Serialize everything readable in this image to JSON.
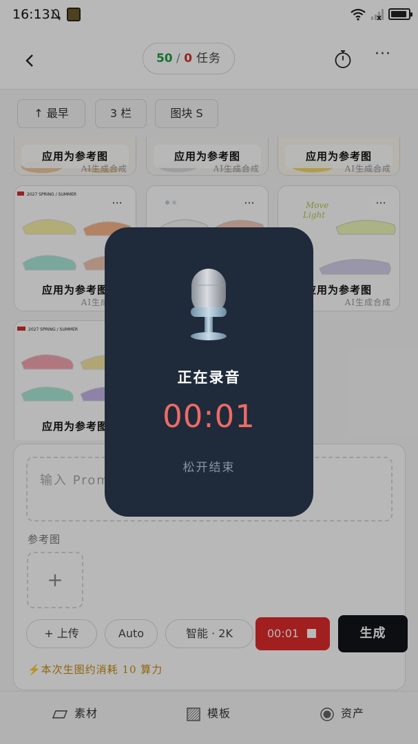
{
  "status_bar": {
    "time": "16:13"
  },
  "header": {
    "back_icon": "chevron-left-icon",
    "tasks_done": "50",
    "tasks_sep": " / ",
    "tasks_failed": "0",
    "tasks_label": "任务",
    "timer_icon": "stopwatch-icon",
    "more_icon": "more-horizontal-icon",
    "more_label": "···"
  },
  "filters": {
    "sort": "↑  最早",
    "columns": "3 栏",
    "tile_size": "图块 S"
  },
  "grid": {
    "apply_label": "应用为参考图",
    "ai_watermark": "AI生成合成",
    "card_more": "···",
    "card_title_text": "2027 SPRING / SUMMER"
  },
  "composer": {
    "prompt_placeholder": "输入 Prompt",
    "reference_label": "参考图",
    "add_reference": "+",
    "upload_button": "+  上传",
    "ratio_button": "Auto",
    "quality_button": "智能  ·  2K",
    "recording_timer": "00:01",
    "generate_button": "生成",
    "cost_note": "⚡本次生图约消耗 10 算力"
  },
  "bottom_nav": {
    "items": [
      {
        "label": "素材",
        "icon": "material-icon"
      },
      {
        "label": "模板",
        "icon": "template-icon"
      },
      {
        "label": "资产",
        "icon": "asset-icon"
      }
    ]
  },
  "recording": {
    "title": "正在录音",
    "time": "00:01",
    "hint": "松开结束",
    "icon": "microphone-icon"
  },
  "colors": {
    "success": "#1f9d45",
    "danger": "#d23030",
    "record_red": "#e02b2b",
    "timer_red": "#ee6a66",
    "dialog_bg": "#1f2a3a",
    "cost_amber": "#c98a12"
  }
}
